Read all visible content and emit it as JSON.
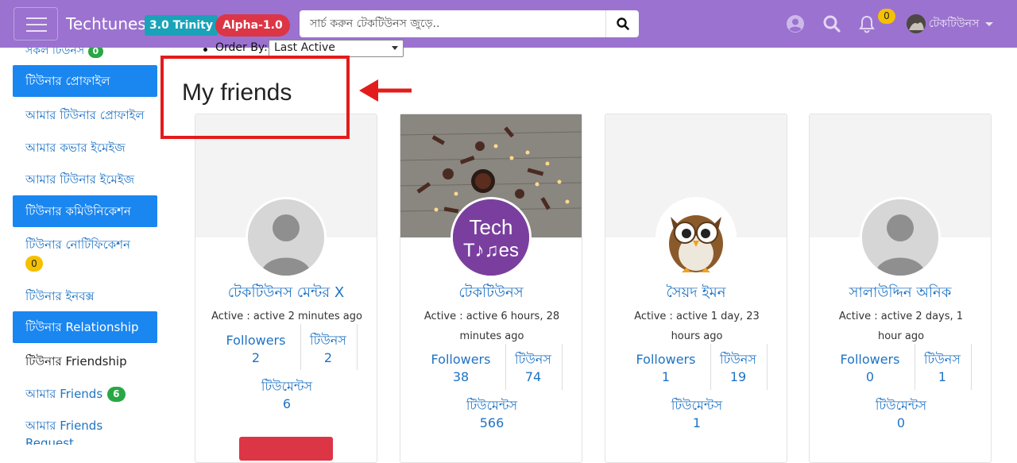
{
  "navbar": {
    "brand": "Techtunes",
    "badge_version": "3.0 Trinity",
    "badge_build": "Alpha-1.0",
    "search_placeholder": "সার্চ করুন টেকটিউনস জুড়ে..",
    "notification_count": "0",
    "user_name": "টেকটিউনস",
    "icons": [
      "menu-icon",
      "search-icon",
      "user-circle-icon",
      "bell-icon",
      "caret-down-icon"
    ]
  },
  "sidebar": {
    "cut_item": {
      "label": "সকল টিউনস",
      "count": "0"
    },
    "sections": [
      {
        "header": "টিউনার প্রোফাইল",
        "links": [
          "আমার টিউনার প্রোফাইল",
          "আমার কভার ইমেইজ",
          "আমার টিউনার ইমেইজ"
        ]
      },
      {
        "header": "টিউনার কমিউনিকেশন",
        "links": [
          "টিউনার নোটিফিকেশন",
          "টিউনার ইনবক্স"
        ],
        "notification_count": "0"
      },
      {
        "header": "টিউনার Relationship",
        "links": [
          "টিউনার Friendship",
          "আমার Friends",
          "আমার Friends Request"
        ],
        "friends_count": "6"
      }
    ]
  },
  "main": {
    "order_by_label": "Order By:",
    "order_by_value": "Last Active",
    "page_title": "My friends",
    "cards": [
      {
        "name": "টেকটিউনস মেন্টর X",
        "active": "Active : active 2 minutes ago",
        "followers_label": "Followers",
        "followers": "2",
        "tunes_label": "টিউনস",
        "tunes": "2",
        "comments_label": "টিউমেন্টস",
        "comments": "6",
        "avatar": "default-person-icon"
      },
      {
        "name": "টেকটিউনস",
        "active": "Active : active 6 hours, 28 minutes ago",
        "followers_label": "Followers",
        "followers": "38",
        "tunes_label": "টিউনস",
        "tunes": "74",
        "comments_label": "টিউমেন্টস",
        "comments": "566",
        "avatar": "techtunes-logo",
        "avatar_text_top": "Tech",
        "avatar_text_bottom": "T♪♫es"
      },
      {
        "name": "সৈয়দ ইমন",
        "active": "Active : active 1 day, 23 hours ago",
        "followers_label": "Followers",
        "followers": "1",
        "tunes_label": "টিউনস",
        "tunes": "19",
        "comments_label": "টিউমেন্টস",
        "comments": "1",
        "avatar": "owl-cartoon"
      },
      {
        "name": "সালাউদ্দিন অনিক",
        "active": "Active : active 2 days, 1 hour ago",
        "followers_label": "Followers",
        "followers": "0",
        "tunes_label": "টিউনস",
        "tunes": "1",
        "comments_label": "টিউমেন্টস",
        "comments": "0",
        "avatar": "default-person-icon"
      }
    ]
  },
  "colors": {
    "navbar": "#9b72cf",
    "sidebar_header": "#1a86f0",
    "link": "#1f73c4",
    "badge_teal": "#1aa3b8",
    "badge_red": "#dc3545",
    "badge_yellow": "#f5c000",
    "badge_green": "#28a745",
    "annotation": "#e41b1b"
  }
}
